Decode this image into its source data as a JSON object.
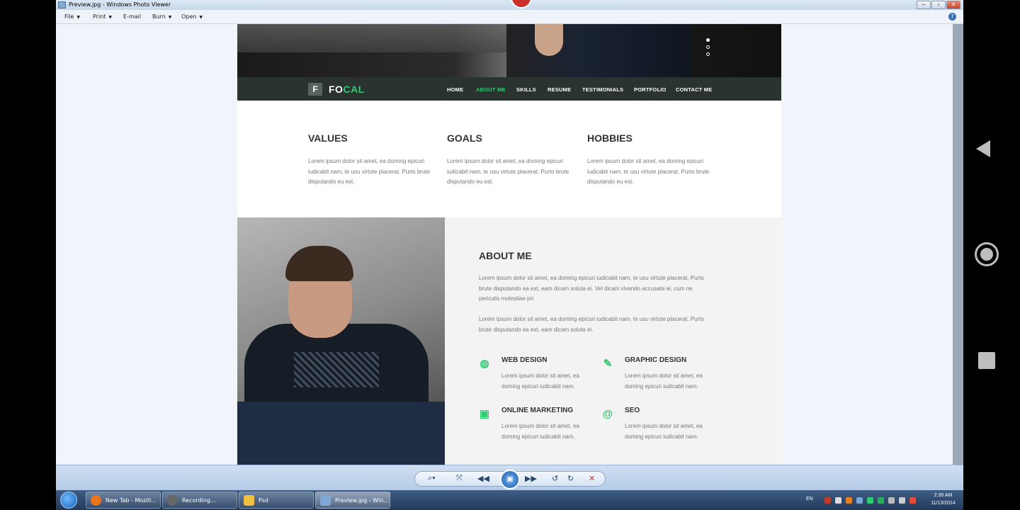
{
  "window": {
    "title": "Preview.jpg - Windows Photo Viewer",
    "menu": [
      {
        "label": "File"
      },
      {
        "label": "Print"
      },
      {
        "label": "E-mail"
      },
      {
        "label": "Burn"
      },
      {
        "label": "Open"
      }
    ],
    "help": "?"
  },
  "site": {
    "logo_letter": "F",
    "logo_fo": "FO",
    "logo_cal": "CAL",
    "nav": [
      "HOME",
      "ABOUT ME",
      "SKILLS",
      "RESUME",
      "TESTIMONIALS",
      "PORTFOLIO",
      "CONTACT ME"
    ],
    "active_nav": "ABOUT ME",
    "columns": [
      {
        "title": "VALUES",
        "text": "Lorem ipsum dolor sit amet, ea doming epicuri iudicabit nam, te usu virtute placerat. Purto brute disputando eu est."
      },
      {
        "title": "GOALS",
        "text": "Lorem ipsum dolor sit amet, ea doming epicuri iudicabit nam, te usu virtute placerat. Purto brute disputando eu est."
      },
      {
        "title": "HOBBIES",
        "text": "Lorem ipsum dolor sit amet, ea doming epicuri iudicabit nam, te usu virtute placerat. Purto brute disputando eu est."
      }
    ],
    "about": {
      "title": "ABOUT ME",
      "p1": "Lorem ipsum dolor sit amet, ea doming epicuri iudicabit nam, te usu virtute placerat. Purto brute disputando ea est, eam dicam soluta ei. Vel dicam vivendo accusata ei, cum ne periculis molestiae pri.",
      "p2": "Lorem ipsum dolor sit amet, ea doming epicuri iudicabit nam, te usu virtute placerat. Purto brute disputando ea est, eam dicam soluta ei."
    },
    "services": [
      {
        "title": "WEB DESIGN",
        "text": "Lorem ipsum dolor sit amet, ea doming epicuri iudicabit nam.",
        "icon": "globe-icon",
        "glyph": "◍"
      },
      {
        "title": "GRAPHIC DESIGN",
        "text": "Lorem ipsum dolor sit amet, ea doming epicuri iudicabit nam.",
        "icon": "pencil-icon",
        "glyph": "✎"
      },
      {
        "title": "ONLINE MARKETING",
        "text": "Lorem ipsum dolor sit amet, ea doming epicuri iudicabit nam.",
        "icon": "briefcase-icon",
        "glyph": "▣"
      },
      {
        "title": "SEO",
        "text": "Lorem ipsum dolor sit amet, ea doming epicuri iudicabit nam.",
        "icon": "at-sign-icon",
        "glyph": "@"
      }
    ],
    "accent": "#2ecc71"
  },
  "taskbar": {
    "items": [
      {
        "label": "New Tab - Mozill...",
        "icon": "firefox-icon",
        "color": "#e8751a"
      },
      {
        "label": "Recording...",
        "icon": "recorder-icon",
        "color": "#666666"
      },
      {
        "label": "Psd",
        "icon": "folder-icon",
        "color": "#f0c040"
      },
      {
        "label": "Preview.jpg - Win...",
        "icon": "photo-viewer-icon",
        "color": "#7fa8d6"
      }
    ],
    "lang": "EN",
    "time": "2:35 AM",
    "date": "11/13/2014"
  }
}
